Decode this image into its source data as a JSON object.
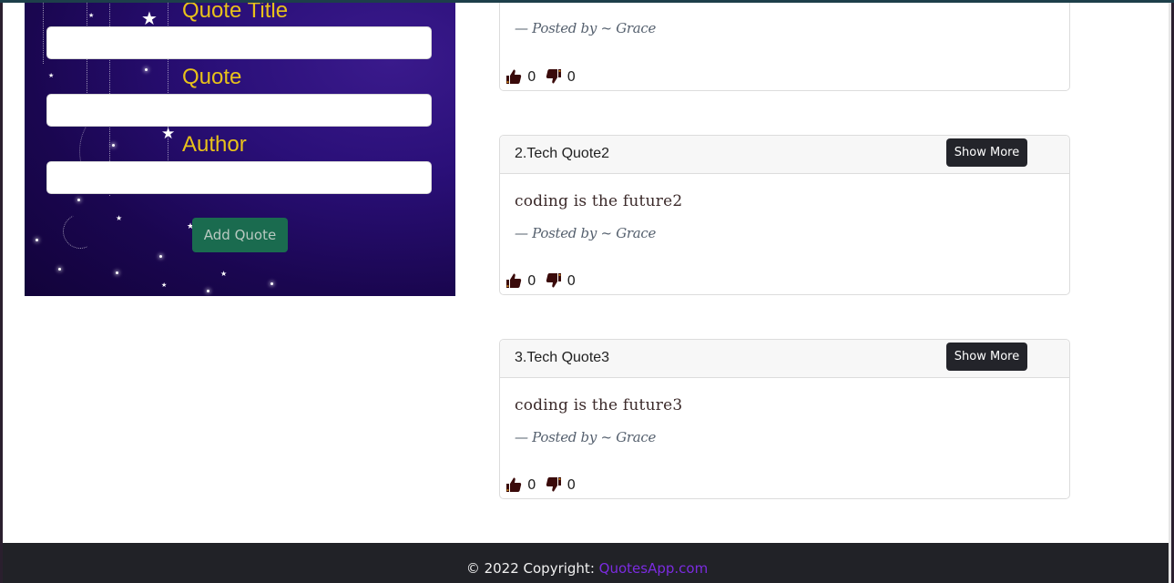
{
  "form": {
    "title_label": "Quote Title",
    "quote_label": "Quote",
    "author_label": "Author",
    "title_value": "",
    "quote_value": "",
    "author_value": "",
    "submit_label": "Add Quote"
  },
  "quotes": [
    {
      "title": "",
      "text": "",
      "posted_by": "— Posted by ~ Grace",
      "upvotes": "0",
      "downvotes": "0"
    },
    {
      "title": "2.Tech Quote2",
      "show_more_label": "Show More",
      "text": "coding is the future2",
      "posted_by": "— Posted by ~ Grace",
      "upvotes": "0",
      "downvotes": "0"
    },
    {
      "title": "3.Tech Quote3",
      "show_more_label": "Show More",
      "text": "coding is the future3",
      "posted_by": "— Posted by ~ Grace",
      "upvotes": "0",
      "downvotes": "0"
    }
  ],
  "footer": {
    "copyright": "© 2022 Copyright:",
    "link_text": "QuotesApp.com"
  },
  "colors": {
    "label_gold": "#e8c21a",
    "add_button": "#1a6b4f",
    "show_more": "#23242a",
    "footer_bg": "#212227",
    "footer_link": "#7b2be0",
    "vote_icon": "#3a0a0a"
  },
  "icons": {
    "upvote": "thumbs-up-icon",
    "downvote": "thumbs-down-icon"
  }
}
